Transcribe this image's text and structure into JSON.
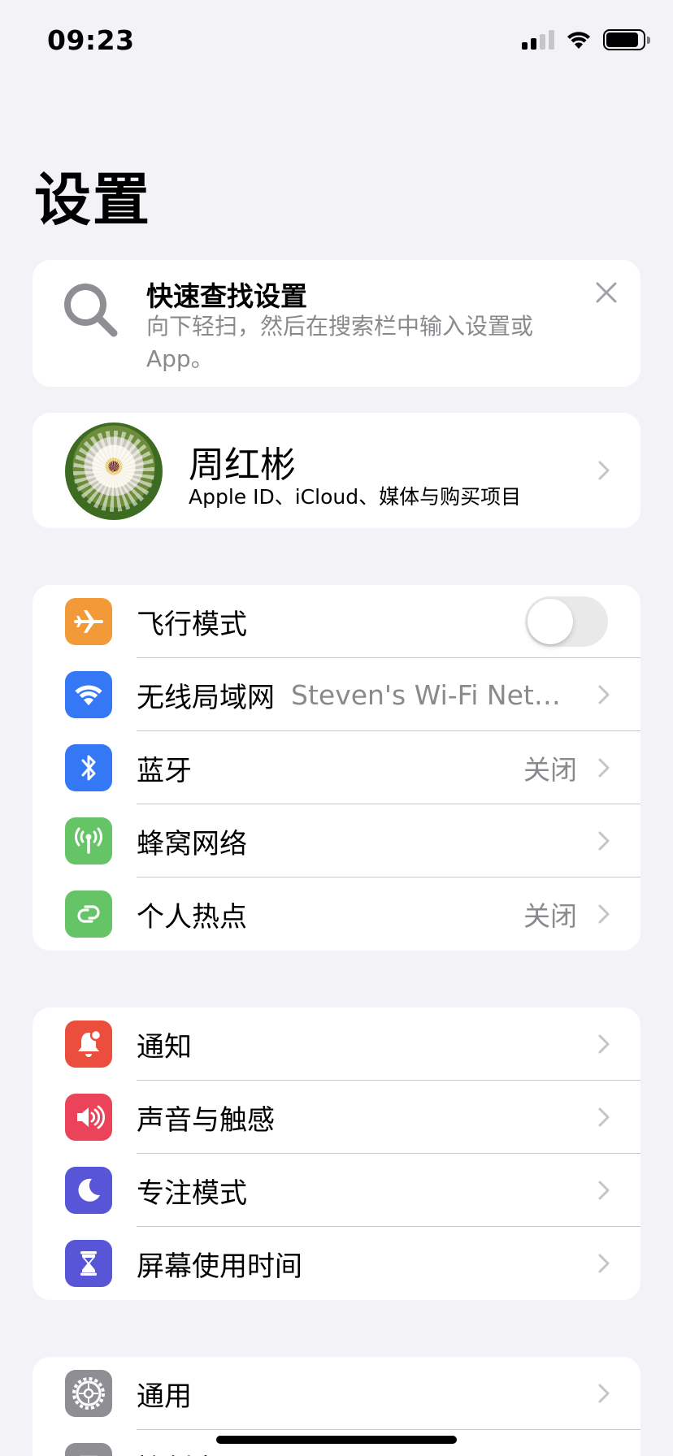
{
  "status_bar": {
    "time": "09:23",
    "battery_level_percent": 90
  },
  "page": {
    "title": "设置"
  },
  "tip": {
    "title": "快速查找设置",
    "description": "向下轻扫，然后在搜索栏中输入设置或 App。",
    "icon": "search-icon"
  },
  "profile": {
    "name": "周红彬",
    "subtitle": "Apple ID、iCloud、媒体与购买项目"
  },
  "connectivity": {
    "airplane": {
      "label": "飞行模式",
      "icon": "airplane-icon",
      "color": "#f19a37",
      "on": false
    },
    "wifi": {
      "label": "无线局域网",
      "value": "Steven's Wi-Fi Netwo...",
      "icon": "wifi-icon",
      "color": "#3478f6"
    },
    "bluetooth": {
      "label": "蓝牙",
      "value": "关闭",
      "icon": "bluetooth-icon",
      "color": "#3478f6"
    },
    "cellular": {
      "label": "蜂窝网络",
      "icon": "cellular-antenna-icon",
      "color": "#65c466"
    },
    "hotspot": {
      "label": "个人热点",
      "value": "关闭",
      "icon": "hotspot-icon",
      "color": "#65c466"
    }
  },
  "notifications_group": {
    "notifications": {
      "label": "通知",
      "icon": "bell-icon",
      "color": "#eb4e3d"
    },
    "sounds": {
      "label": "声音与触感",
      "icon": "speaker-icon",
      "color": "#eb445a"
    },
    "focus": {
      "label": "专注模式",
      "icon": "moon-icon",
      "color": "#5856d6"
    },
    "screen_time": {
      "label": "屏幕使用时间",
      "icon": "hourglass-icon",
      "color": "#5856d6"
    }
  },
  "general_group": {
    "general": {
      "label": "通用",
      "icon": "gear-icon",
      "color": "#8e8e93"
    },
    "control_center": {
      "label": "控制中心",
      "icon": "control-center-icon",
      "color": "#8e8e93"
    }
  }
}
